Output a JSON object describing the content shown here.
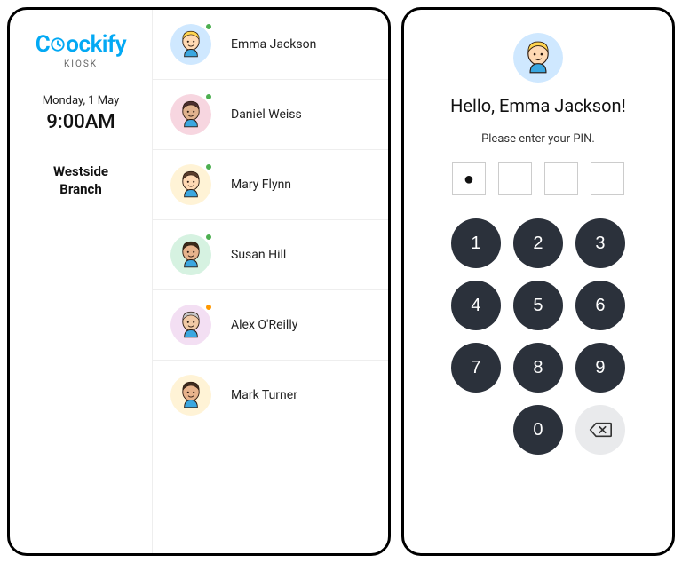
{
  "brand": {
    "name_prefix": "C",
    "name_rest": "ockify",
    "sub": "KIOSK"
  },
  "date": "Monday, 1 May",
  "time": "9:00AM",
  "branch": "Westside\nBranch",
  "users": [
    {
      "name": "Emma Jackson",
      "status_color": "#4CAF50",
      "avatar_bg": "#cfe8ff",
      "avatar_hair": "#ffd54f",
      "avatar_skin": "#ffd9b3"
    },
    {
      "name": "Daniel Weiss",
      "status_color": "#4CAF50",
      "avatar_bg": "#f7d6e0",
      "avatar_hair": "#4b2e2e",
      "avatar_skin": "#e0b28e"
    },
    {
      "name": "Mary Flynn",
      "status_color": "#4CAF50",
      "avatar_bg": "#fff3d6",
      "avatar_hair": "#5a3d2b",
      "avatar_skin": "#ffd9b3"
    },
    {
      "name": "Susan Hill",
      "status_color": "#4CAF50",
      "avatar_bg": "#d6f2e1",
      "avatar_hair": "#3b2a1a",
      "avatar_skin": "#e7b38c"
    },
    {
      "name": "Alex O'Reilly",
      "status_color": "#FF9800",
      "avatar_bg": "#f3dff3",
      "avatar_hair": "#c7c7c7",
      "avatar_skin": "#f1c9a5"
    },
    {
      "name": "Mark Turner",
      "status_color": null,
      "avatar_bg": "#fff3d6",
      "avatar_hair": "#3d2b1f",
      "avatar_skin": "#e7b38c"
    }
  ],
  "pin_screen": {
    "user_index": 0,
    "greeting_prefix": "Hello, ",
    "greeting_suffix": "!",
    "prompt": "Please enter your PIN.",
    "entered": [
      true,
      false,
      false,
      false
    ],
    "keys": [
      "1",
      "2",
      "3",
      "4",
      "5",
      "6",
      "7",
      "8",
      "9",
      "",
      "0",
      "backspace"
    ]
  }
}
